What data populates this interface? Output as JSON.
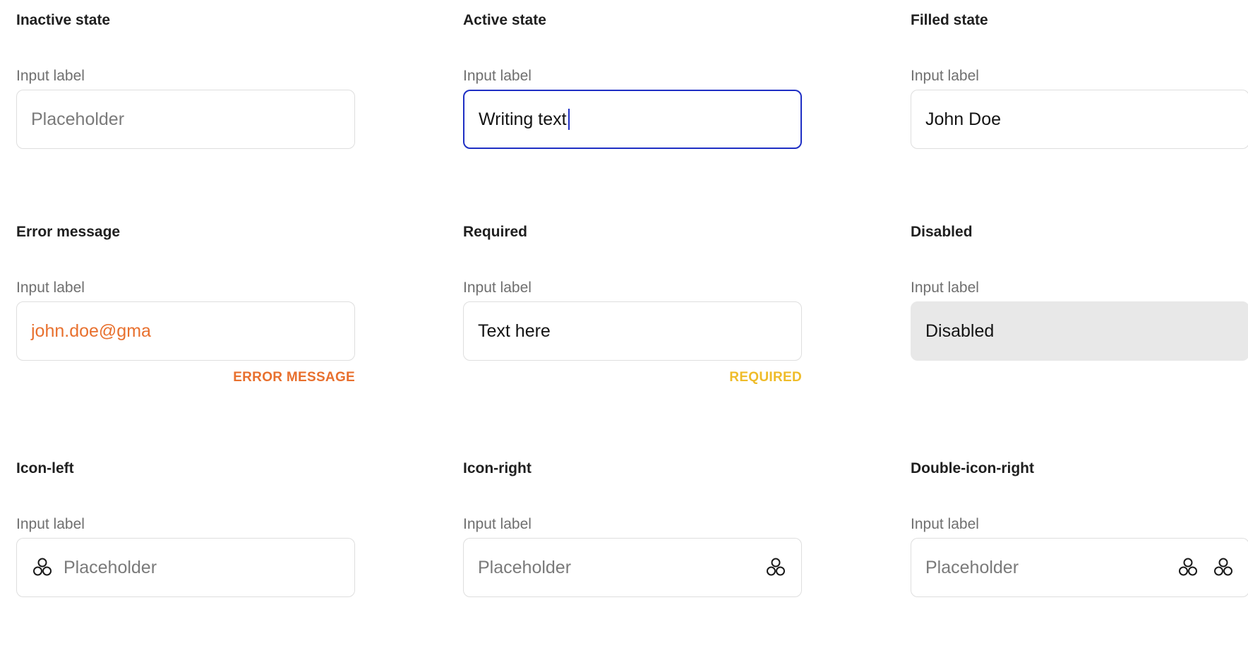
{
  "icon_name": "three-circles-icon",
  "colors": {
    "active_border": "#1f2fc4",
    "error": "#e8702e",
    "required": "#efbc2a",
    "disabled_bg": "#e8e8e8"
  },
  "cells": [
    {
      "heading": "Inactive state",
      "label": "Input label",
      "placeholder": "Placeholder"
    },
    {
      "heading": "Active state",
      "label": "Input label",
      "value": "Writing text"
    },
    {
      "heading": "Filled state",
      "label": "Input label",
      "value": "John Doe"
    },
    {
      "heading": "Error message",
      "label": "Input label",
      "value": "john.doe@gma",
      "helper": "ERROR MESSAGE"
    },
    {
      "heading": "Required",
      "label": "Input label",
      "value": "Text here",
      "helper": "REQUIRED"
    },
    {
      "heading": "Disabled",
      "label": "Input label",
      "value": "Disabled"
    },
    {
      "heading": "Icon-left",
      "label": "Input label",
      "placeholder": "Placeholder"
    },
    {
      "heading": "Icon-right",
      "label": "Input label",
      "placeholder": "Placeholder"
    },
    {
      "heading": "Double-icon-right",
      "label": "Input label",
      "placeholder": "Placeholder"
    }
  ]
}
